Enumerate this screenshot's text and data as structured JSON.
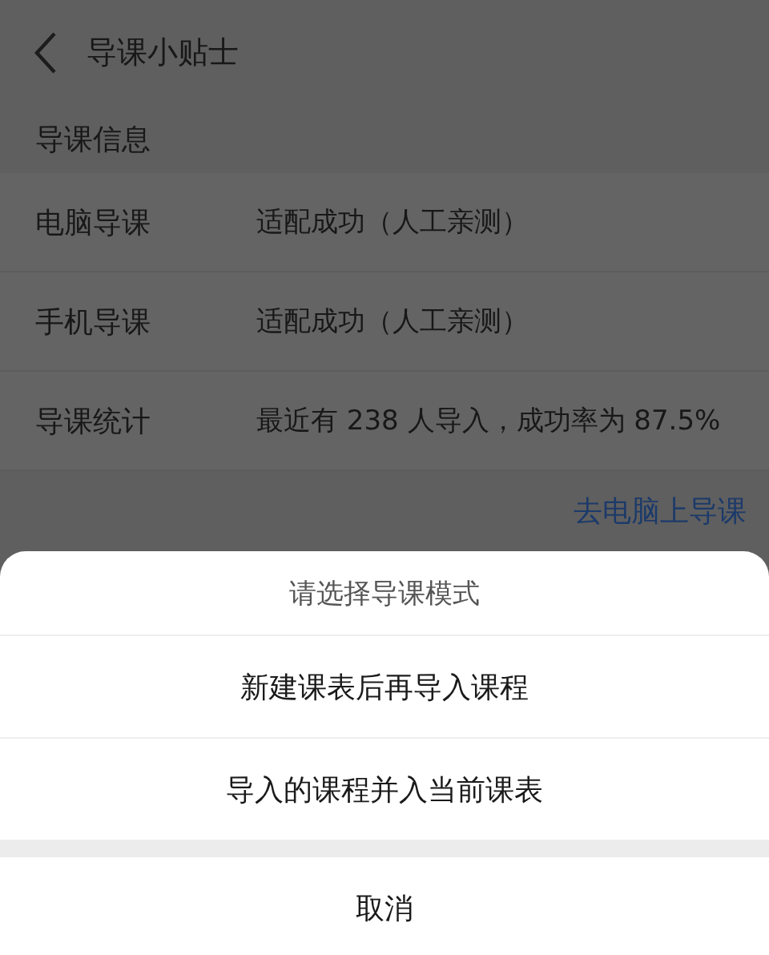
{
  "header": {
    "title": "导课小贴士"
  },
  "section": {
    "title": "导课信息"
  },
  "rows": [
    {
      "label": "电脑导课",
      "value": "适配成功（人工亲测）"
    },
    {
      "label": "手机导课",
      "value": "适配成功（人工亲测）"
    },
    {
      "label": "导课统计",
      "value": "最近有 238 人导入，成功率为 87.5%"
    }
  ],
  "link": "去电脑上导课",
  "sheet": {
    "title": "请选择导课模式",
    "options": [
      "新建课表后再导入课程",
      "导入的课程并入当前课表"
    ],
    "cancel": "取消"
  }
}
